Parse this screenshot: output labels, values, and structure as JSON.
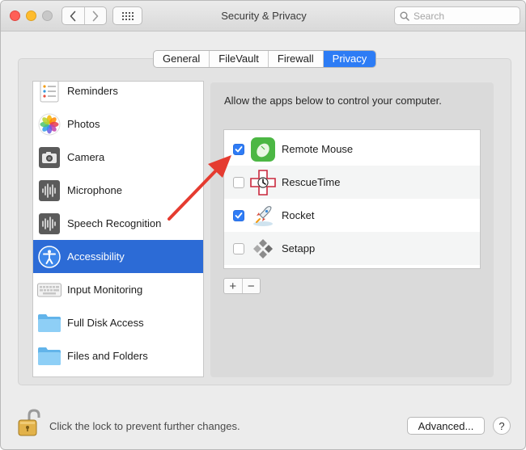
{
  "window": {
    "title": "Security & Privacy"
  },
  "search": {
    "placeholder": "Search"
  },
  "tabs": [
    {
      "label": "General",
      "active": false
    },
    {
      "label": "FileVault",
      "active": false
    },
    {
      "label": "Firewall",
      "active": false
    },
    {
      "label": "Privacy",
      "active": true
    }
  ],
  "sidebar": {
    "items": [
      {
        "label": "Reminders",
        "icon": "reminders-icon"
      },
      {
        "label": "Photos",
        "icon": "photos-icon"
      },
      {
        "label": "Camera",
        "icon": "camera-icon"
      },
      {
        "label": "Microphone",
        "icon": "microphone-icon"
      },
      {
        "label": "Speech Recognition",
        "icon": "speech-recognition-icon"
      },
      {
        "label": "Accessibility",
        "icon": "accessibility-icon",
        "selected": true
      },
      {
        "label": "Input Monitoring",
        "icon": "keyboard-icon"
      },
      {
        "label": "Full Disk Access",
        "icon": "folder-icon"
      },
      {
        "label": "Files and Folders",
        "icon": "folder-icon"
      }
    ]
  },
  "privacy_pane": {
    "instruction": "Allow the apps below to control your computer.",
    "apps": [
      {
        "name": "Remote Mouse",
        "checked": true,
        "icon": "remote-mouse-icon"
      },
      {
        "name": "RescueTime",
        "checked": false,
        "icon": "rescuetime-icon"
      },
      {
        "name": "Rocket",
        "checked": true,
        "icon": "rocket-icon"
      },
      {
        "name": "Setapp",
        "checked": false,
        "icon": "setapp-icon"
      }
    ],
    "add_label": "+",
    "remove_label": "−"
  },
  "footer": {
    "lock_message": "Click the lock to prevent further changes.",
    "advanced_label": "Advanced...",
    "help_label": "?"
  },
  "colors": {
    "accent": "#2d7cf5",
    "selection": "#2c6bd6",
    "annotation_arrow": "#e53b30"
  }
}
